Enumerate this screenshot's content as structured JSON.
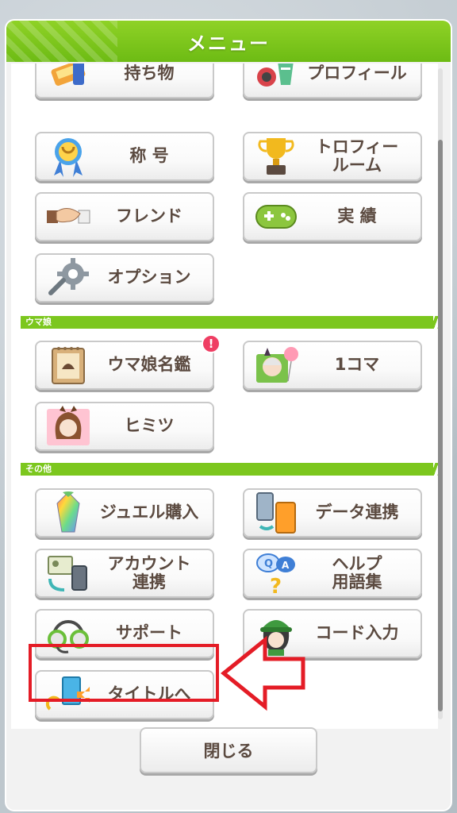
{
  "header": {
    "title": "メニュー"
  },
  "buttons": {
    "mochimono": "持ち物",
    "profile": "プロフィール",
    "title": "称 号",
    "trophy": "トロフィー\nルーム",
    "friend": "フレンド",
    "achievements": "実 績",
    "options": "オプション",
    "umamusume_guide": "ウマ娘名鑑",
    "one_koma": "1コマ",
    "himitsu": "ヒミツ",
    "jewel": "ジュエル購入",
    "data_link": "データ連携",
    "account": "アカウント\n連携",
    "help": "ヘルプ\n用語集",
    "support": "サポート",
    "code": "コード入力",
    "to_title": "タイトルへ"
  },
  "sections": {
    "umamusume": "ウマ娘",
    "other": "その他"
  },
  "badge": "!",
  "close_label": "閉じる",
  "colors": {
    "accent_green": "#7cc71e",
    "label_brown": "#5b4a40",
    "highlight_red": "#e41c26"
  }
}
